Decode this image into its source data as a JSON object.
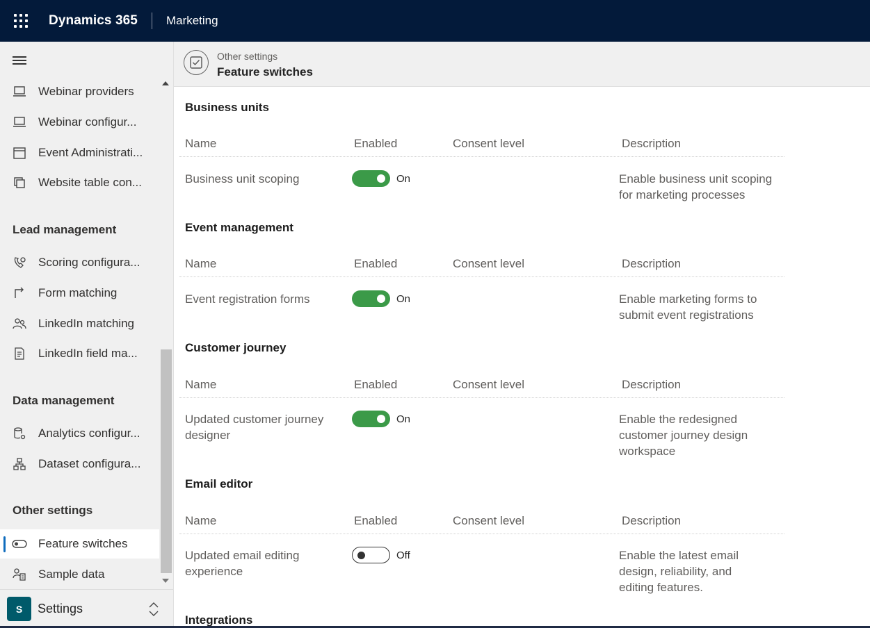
{
  "topbar": {
    "brand": "Dynamics 365",
    "app": "Marketing"
  },
  "sidebar": {
    "items_top": [
      {
        "label": "Webinar providers",
        "icon": "laptop-icon"
      },
      {
        "label": "Webinar configur...",
        "icon": "laptop-icon"
      },
      {
        "label": "Event Administrati...",
        "icon": "calendar-icon"
      },
      {
        "label": "Website table con...",
        "icon": "window-stack-icon"
      }
    ],
    "lead_title": "Lead management",
    "lead_items": [
      {
        "label": "Scoring configura...",
        "icon": "scoring-icon"
      },
      {
        "label": "Form matching",
        "icon": "arrow-turn-icon"
      },
      {
        "label": "LinkedIn matching",
        "icon": "people-icon"
      },
      {
        "label": "LinkedIn field ma...",
        "icon": "document-list-icon"
      }
    ],
    "data_title": "Data management",
    "data_items": [
      {
        "label": "Analytics configur...",
        "icon": "database-gear-icon"
      },
      {
        "label": "Dataset configura...",
        "icon": "hierarchy-icon"
      }
    ],
    "other_title": "Other settings",
    "other_items": [
      {
        "label": "Feature switches",
        "icon": "toggle-icon"
      },
      {
        "label": "Sample data",
        "icon": "people-data-icon"
      }
    ],
    "area": {
      "badge": "S",
      "label": "Settings"
    }
  },
  "header": {
    "breadcrumb": "Other settings",
    "title": "Feature switches"
  },
  "columns": {
    "name": "Name",
    "enabled": "Enabled",
    "consent": "Consent level",
    "description": "Description"
  },
  "groups": [
    {
      "title": "Business units",
      "rows": [
        {
          "name_lines": [
            "Business unit scoping"
          ],
          "enabled": true,
          "state": "On",
          "consent": "",
          "desc_lines": [
            "Enable business unit scoping",
            "for marketing processes"
          ]
        }
      ]
    },
    {
      "title": "Event management",
      "rows": [
        {
          "name_lines": [
            "Event registration forms"
          ],
          "enabled": true,
          "state": "On",
          "consent": "",
          "desc_lines": [
            "Enable marketing forms to",
            "submit event registrations"
          ]
        }
      ]
    },
    {
      "title": "Customer journey",
      "rows": [
        {
          "name_lines": [
            "Updated customer journey",
            "designer"
          ],
          "enabled": true,
          "state": "On",
          "consent": "",
          "desc_lines": [
            "Enable the redesigned",
            "customer journey design",
            "workspace"
          ]
        }
      ]
    },
    {
      "title": "Email editor",
      "rows": [
        {
          "name_lines": [
            "Updated email editing",
            "experience"
          ],
          "enabled": false,
          "state": "Off",
          "consent": "",
          "desc_lines": [
            "Enable the latest email",
            "design, reliability, and",
            "editing features."
          ]
        }
      ]
    },
    {
      "title": "Integrations",
      "rows": []
    }
  ],
  "colors": {
    "topbar": "#031a3a",
    "toggle_on": "#3b9a48",
    "accent": "#0f6cbd",
    "area_badge": "#005a6a"
  }
}
